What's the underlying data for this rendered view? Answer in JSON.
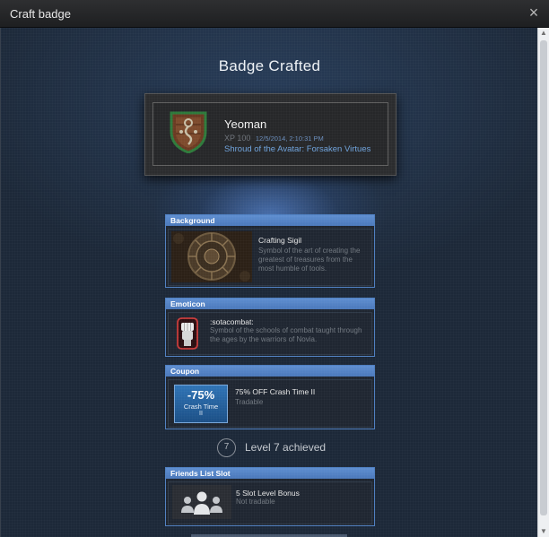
{
  "window": {
    "title": "Craft badge",
    "close_glyph": "×"
  },
  "heading": "Badge Crafted",
  "badge": {
    "name": "Yeoman",
    "xp": "XP 100",
    "date": "12/5/2014, 2:10:31 PM",
    "game": "Shroud of the Avatar: Forsaken Virtues",
    "icon": "shield-sigil-icon"
  },
  "rewards": [
    {
      "type": "Background",
      "title": "Crafting Sigil",
      "desc": "Symbol of the art of creating the greatest of treasures from the most humble of tools.",
      "icon": "crafting-sigil-thumbnail"
    },
    {
      "type": "Emoticon",
      "title": ":sotacombat:",
      "desc": "Symbol of the schools of combat taught through the ages by the warriors of Novia.",
      "icon": "raised-fist-icon"
    },
    {
      "type": "Coupon",
      "title": "75% OFF Crash Time II",
      "desc": "Tradable",
      "icon": "coupon-icon",
      "coupon_discount": "-75%",
      "coupon_game": "Crash Time",
      "coupon_game_num": "II"
    },
    {
      "type": "Friends List Slot",
      "title": "5 Slot Level Bonus",
      "desc": "Not tradable",
      "icon": "friends-slot-icon"
    }
  ],
  "level": {
    "number": "7",
    "text": "Level 7 achieved"
  },
  "colors": {
    "accent": "#4f7fc1",
    "background": "#1b2533",
    "link": "#6fa3dc"
  }
}
